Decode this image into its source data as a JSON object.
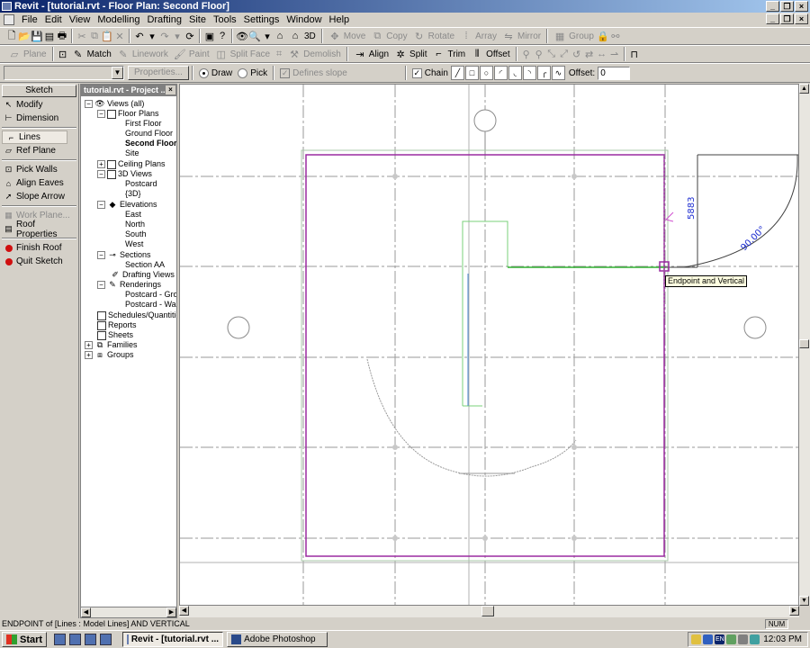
{
  "window": {
    "title": "Revit - [tutorial.rvt - Floor Plan: Second Floor]"
  },
  "menu": [
    "File",
    "Edit",
    "View",
    "Modelling",
    "Drafting",
    "Site",
    "Tools",
    "Settings",
    "Window",
    "Help"
  ],
  "toolbar1": {
    "view_3d_label": "3D",
    "move_label": "Move",
    "copy_label": "Copy",
    "rotate_label": "Rotate",
    "array_label": "Array",
    "mirror_label": "Mirror",
    "group_label": "Group"
  },
  "toolbar2": {
    "plane_label": "Plane",
    "match_label": "Match",
    "linework_label": "Linework",
    "paint_label": "Paint",
    "split_face_label": "Split Face",
    "demolish_label": "Demolish",
    "align_label": "Align",
    "split_label": "Split",
    "trim_label": "Trim",
    "offset_label": "Offset"
  },
  "options_bar": {
    "type_selector_value": "",
    "properties_label": "Properties...",
    "draw_label": "Draw",
    "pick_label": "Pick",
    "draw_selected": true,
    "defines_slope_label": "Defines slope",
    "chain_label": "Chain",
    "chain_checked": true,
    "offset_label": "Offset:",
    "offset_value": "0"
  },
  "sketch_panel": {
    "header": "Sketch",
    "items": [
      {
        "label": "Modify",
        "icon": "arrow-cursor-icon"
      },
      {
        "label": "Dimension",
        "icon": "dimension-icon"
      },
      {
        "label": "Lines",
        "icon": "lines-icon",
        "active": true
      },
      {
        "label": "Ref Plane",
        "icon": "ref-plane-icon"
      },
      {
        "label": "Pick Walls",
        "icon": "pick-walls-icon"
      },
      {
        "label": "Align Eaves",
        "icon": "align-eaves-icon"
      },
      {
        "label": "Slope Arrow",
        "icon": "slope-arrow-icon"
      },
      {
        "label": "Work Plane...",
        "icon": "work-plane-icon",
        "disabled": true
      },
      {
        "label": "Roof Properties",
        "icon": "roof-properties-icon"
      },
      {
        "label": "Finish Roof",
        "icon": "finish-roof-icon"
      },
      {
        "label": "Quit Sketch",
        "icon": "quit-sketch-icon"
      }
    ]
  },
  "project_browser": {
    "title": "tutorial.rvt - Project ...",
    "nodes": {
      "views_all": "Views (all)",
      "floor_plans": "Floor Plans",
      "first_floor": "First Floor",
      "ground_floor": "Ground Floor",
      "second_floor": "Second Floor",
      "site": "Site",
      "ceiling_plans": "Ceiling Plans",
      "views_3d": "3D Views",
      "postcard": "Postcard",
      "view_3d": "{3D}",
      "elevations": "Elevations",
      "east": "East",
      "north": "North",
      "south": "South",
      "west": "West",
      "sections": "Sections",
      "section_aa": "Section AA",
      "drafting_views": "Drafting Views",
      "renderings": "Renderings",
      "postcard_ground": "Postcard - Grou",
      "postcard_wall": "Postcard - Wall-",
      "schedules": "Schedules/Quantities",
      "reports": "Reports",
      "sheets": "Sheets",
      "families": "Families",
      "groups": "Groups"
    }
  },
  "canvas": {
    "dimension_text": "5883",
    "angle_text": "90.00°",
    "snap_tooltip": "Endpoint and Vertical"
  },
  "status_bar": {
    "message": "ENDPOINT of [Lines : Model Lines] AND VERTICAL",
    "num_indicator": "NUM"
  },
  "taskbar": {
    "start_label": "Start",
    "tasks": [
      {
        "label": "Revit - [tutorial.rvt ...",
        "active": true
      },
      {
        "label": "Adobe Photoshop",
        "active": false
      }
    ],
    "tray_lang": "EN",
    "clock": "12:03 PM"
  },
  "colors": {
    "sketch_magenta": "#9a2aa0",
    "wall_green": "#7ad07a",
    "dim_blue": "#1a2ad0",
    "grid_gray": "#9a9a9a"
  }
}
